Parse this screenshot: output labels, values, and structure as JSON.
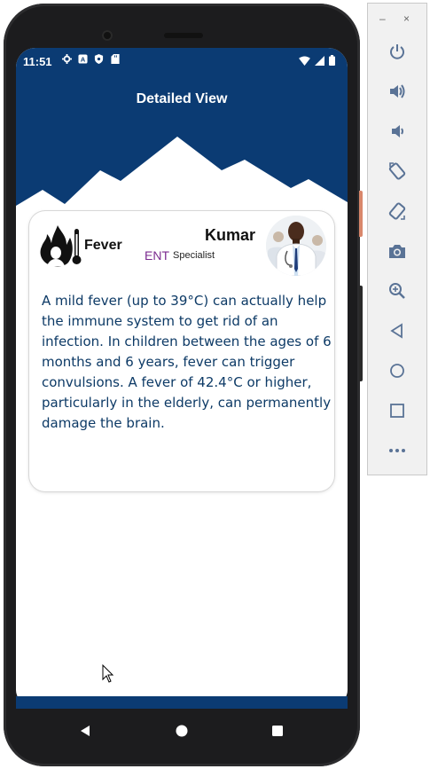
{
  "status_bar": {
    "time": "11:51",
    "icons": [
      "settings-icon",
      "a-badge-icon",
      "shield-icon",
      "sd-card-icon"
    ],
    "right_icons": [
      "wifi-icon",
      "signal-icon",
      "battery-icon"
    ]
  },
  "app_bar": {
    "title": "Detailed View"
  },
  "card": {
    "disease": "Fever",
    "doctor_name": "Kumar",
    "department": "ENT",
    "role": "Specialist",
    "description": "A mild fever (up to 39°C) can actually help the immune system to get rid of an infection. In children between the ages of 6 months and 6 years, fever can trigger convulsions. A fever of 42.4°C or higher, particularly in the elderly, can permanently damage the brain."
  },
  "colors": {
    "primary": "#0b3b73",
    "department": "#7b2a8f",
    "body_text": "#0d3a66"
  },
  "nav": {
    "buttons": [
      "back-icon",
      "home-icon",
      "recents-icon"
    ]
  },
  "emulator_toolbar": {
    "window_controls": {
      "minimize": "–",
      "close": "×"
    },
    "buttons": [
      "power-icon",
      "volume-up-icon",
      "volume-down-icon",
      "rotate-left-icon",
      "rotate-right-icon",
      "camera-icon",
      "zoom-icon",
      "back-icon",
      "home-icon",
      "overview-icon",
      "more-icon"
    ]
  }
}
